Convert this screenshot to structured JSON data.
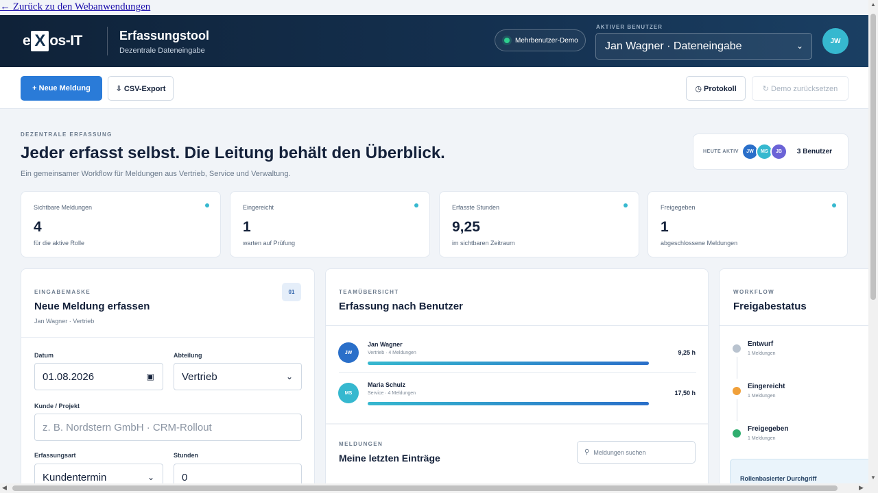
{
  "back_link": "← Zurück zu den Webanwendungen",
  "header": {
    "logo_pre": "e",
    "logo_x": "X",
    "logo_post": "os-IT",
    "app_title": "Erfassungstool",
    "app_subtitle": "Dezentrale Dateneingabe",
    "demo_label": "Mehrbenutzer-Demo",
    "active_user_label": "AKTIVER BENUTZER",
    "active_user_value": "Jan Wagner · Dateneingabe",
    "avatar": "JW"
  },
  "toolbar": {
    "new_report": "+ Neue Meldung",
    "csv_export": "⇩ CSV-Export",
    "protocol": "◷ Protokoll",
    "reset_demo": "↻ Demo zurücksetzen"
  },
  "hero": {
    "eyebrow": "DEZENTRALE ERFASSUNG",
    "title": "Jeder erfasst selbst. Die Leitung behält den Überblick.",
    "subtitle": "Ein gemeinsamer Workflow für Meldungen aus Vertrieb, Service und Verwaltung.",
    "active_label": "HEUTE AKTIV",
    "active_avatars": [
      {
        "initials": "JW",
        "color": "#2a6fc9"
      },
      {
        "initials": "MS",
        "color": "#36b8cf"
      },
      {
        "initials": "JB",
        "color": "#6b63d6"
      }
    ],
    "active_count": "3 Benutzer"
  },
  "stats": [
    {
      "label": "Sichtbare Meldungen",
      "value": "4",
      "hint": "für die aktive Rolle"
    },
    {
      "label": "Eingereicht",
      "value": "1",
      "hint": "warten auf Prüfung"
    },
    {
      "label": "Erfasste Stunden",
      "value": "9,25",
      "hint": "im sichtbaren Zeitraum"
    },
    {
      "label": "Freigegeben",
      "value": "1",
      "hint": "abgeschlossene Meldungen"
    }
  ],
  "form": {
    "eyebrow": "EINGABEMASKE",
    "title": "Neue Meldung erfassen",
    "subtitle": "Jan Wagner · Vertrieb",
    "badge": "01",
    "date_label": "Datum",
    "date_value": "01.08.2026",
    "department_label": "Abteilung",
    "department_value": "Vertrieb",
    "customer_label": "Kunde / Projekt",
    "customer_placeholder": "z. B. Nordstern GmbH · CRM-Rollout",
    "type_label": "Erfassungsart",
    "type_value": "Kundentermin",
    "hours_label": "Stunden",
    "hours_value": "0"
  },
  "team": {
    "eyebrow": "TEAMÜBERSICHT",
    "title": "Erfassung nach Benutzer",
    "users": [
      {
        "initials": "JW",
        "color": "#2a6fc9",
        "name": "Jan Wagner",
        "meta": "Vertrieb · 4 Meldungen",
        "hours": "9,25 h",
        "progress": 1.0
      },
      {
        "initials": "MS",
        "color": "#36b8cf",
        "name": "Maria Schulz",
        "meta": "Service · 4 Meldungen",
        "hours": "17,50 h",
        "progress": 1.0
      }
    ],
    "entries_eyebrow": "MELDUNGEN",
    "entries_title": "Meine letzten Einträge",
    "search_placeholder": "Meldungen suchen"
  },
  "workflow": {
    "eyebrow": "WORKFLOW",
    "title": "Freigabestatus",
    "steps": [
      {
        "name": "Entwurf",
        "count": "1 Meldungen",
        "color": "#b9c3cf"
      },
      {
        "name": "Eingereicht",
        "count": "1 Meldungen",
        "color": "#f0a03a"
      },
      {
        "name": "Freigegeben",
        "count": "1 Meldungen",
        "color": "#2fae6e"
      }
    ],
    "role_box": "Rollenbasierter Durchgriff"
  }
}
